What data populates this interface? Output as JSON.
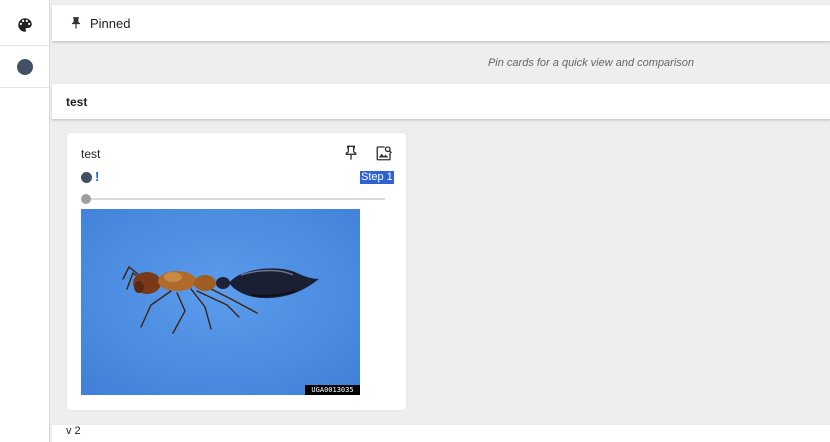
{
  "sidebar": {
    "items": [
      {
        "icon": "palette-icon"
      },
      {
        "icon": "run-color-dot",
        "color": "#425066"
      }
    ]
  },
  "pinned": {
    "icon": "pin-icon",
    "label": "Pinned",
    "hint": "Pin cards for a quick view and comparison"
  },
  "group": {
    "title": "test"
  },
  "card": {
    "title": "test",
    "run_color": "#425066",
    "warning_glyph": "!",
    "step_label": "Step 1",
    "step_slider_value": 0,
    "image_tag": "UGA0013035"
  },
  "next_group": {
    "title": "v 2"
  },
  "colors": {
    "accent": "#2c62d6",
    "run": "#425066",
    "image_background": "#4d8ee0"
  }
}
